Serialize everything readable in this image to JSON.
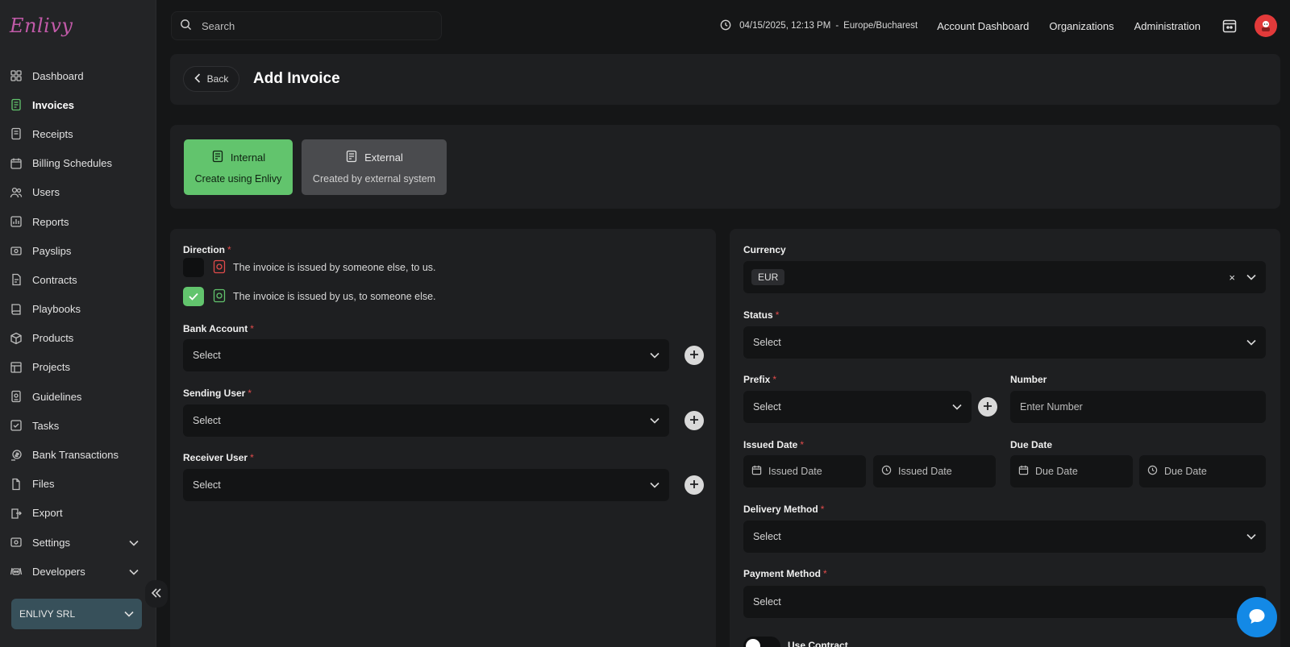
{
  "app": {
    "logo_text": "Enlivy"
  },
  "sidebar": {
    "items": [
      {
        "label": "Dashboard",
        "icon": "dashboard-icon"
      },
      {
        "label": "Invoices",
        "icon": "invoice-icon",
        "active": true
      },
      {
        "label": "Receipts",
        "icon": "receipt-icon"
      },
      {
        "label": "Billing Schedules",
        "icon": "billing-schedule-icon"
      },
      {
        "label": "Users",
        "icon": "users-icon"
      },
      {
        "label": "Reports",
        "icon": "reports-icon"
      },
      {
        "label": "Payslips",
        "icon": "payslips-icon"
      },
      {
        "label": "Contracts",
        "icon": "contracts-icon"
      },
      {
        "label": "Playbooks",
        "icon": "playbooks-icon"
      },
      {
        "label": "Products",
        "icon": "products-icon"
      },
      {
        "label": "Projects",
        "icon": "projects-icon"
      },
      {
        "label": "Guidelines",
        "icon": "guidelines-icon"
      },
      {
        "label": "Tasks",
        "icon": "tasks-icon"
      },
      {
        "label": "Bank Transactions",
        "icon": "bank-icon"
      },
      {
        "label": "Files",
        "icon": "files-icon"
      },
      {
        "label": "Export",
        "icon": "export-icon"
      },
      {
        "label": "Settings",
        "icon": "settings-icon",
        "expandable": true
      },
      {
        "label": "Developers",
        "icon": "developers-icon",
        "expandable": true
      }
    ],
    "organization": "ENLIVY SRL"
  },
  "topbar": {
    "search_placeholder": "Search",
    "datetime": "04/15/2025, 12:13 PM",
    "separator": "-",
    "timezone": "Europe/Bucharest",
    "links": [
      "Account Dashboard",
      "Organizations",
      "Administration"
    ]
  },
  "header": {
    "back_label": "Back",
    "title": "Add Invoice"
  },
  "invoice_type": {
    "internal": {
      "title": "Internal",
      "subtitle": "Create using Enlivy",
      "selected": true
    },
    "external": {
      "title": "External",
      "subtitle": "Created by external system",
      "selected": false
    }
  },
  "form_left": {
    "direction": {
      "label": "Direction",
      "options": [
        {
          "text": "The invoice is issued by someone else, to us.",
          "checked": false
        },
        {
          "text": "The invoice is issued by us, to someone else.",
          "checked": true
        }
      ]
    },
    "bank_account": {
      "label": "Bank Account",
      "value": "Select"
    },
    "sending_user": {
      "label": "Sending User",
      "value": "Select"
    },
    "receiver_user": {
      "label": "Receiver User",
      "value": "Select"
    }
  },
  "form_right": {
    "currency": {
      "label": "Currency",
      "value": "EUR",
      "clear": "×"
    },
    "status": {
      "label": "Status",
      "value": "Select"
    },
    "prefix": {
      "label": "Prefix",
      "value": "Select"
    },
    "number": {
      "label": "Number",
      "placeholder": "Enter Number"
    },
    "issued_date": {
      "label": "Issued Date",
      "date_placeholder": "Issued Date",
      "time_placeholder": "Issued Date"
    },
    "due_date": {
      "label": "Due Date",
      "date_placeholder": "Due Date",
      "time_placeholder": "Due Date"
    },
    "delivery_method": {
      "label": "Delivery Method",
      "value": "Select"
    },
    "payment_method": {
      "label": "Payment Method",
      "value": "Select"
    },
    "use_contract": {
      "label": "Use Contract",
      "enabled": false
    }
  },
  "colors": {
    "accent_green": "#62c46d",
    "required_red": "#e24b4b",
    "chat_blue": "#1389e6",
    "org_badge": "#37505a"
  }
}
